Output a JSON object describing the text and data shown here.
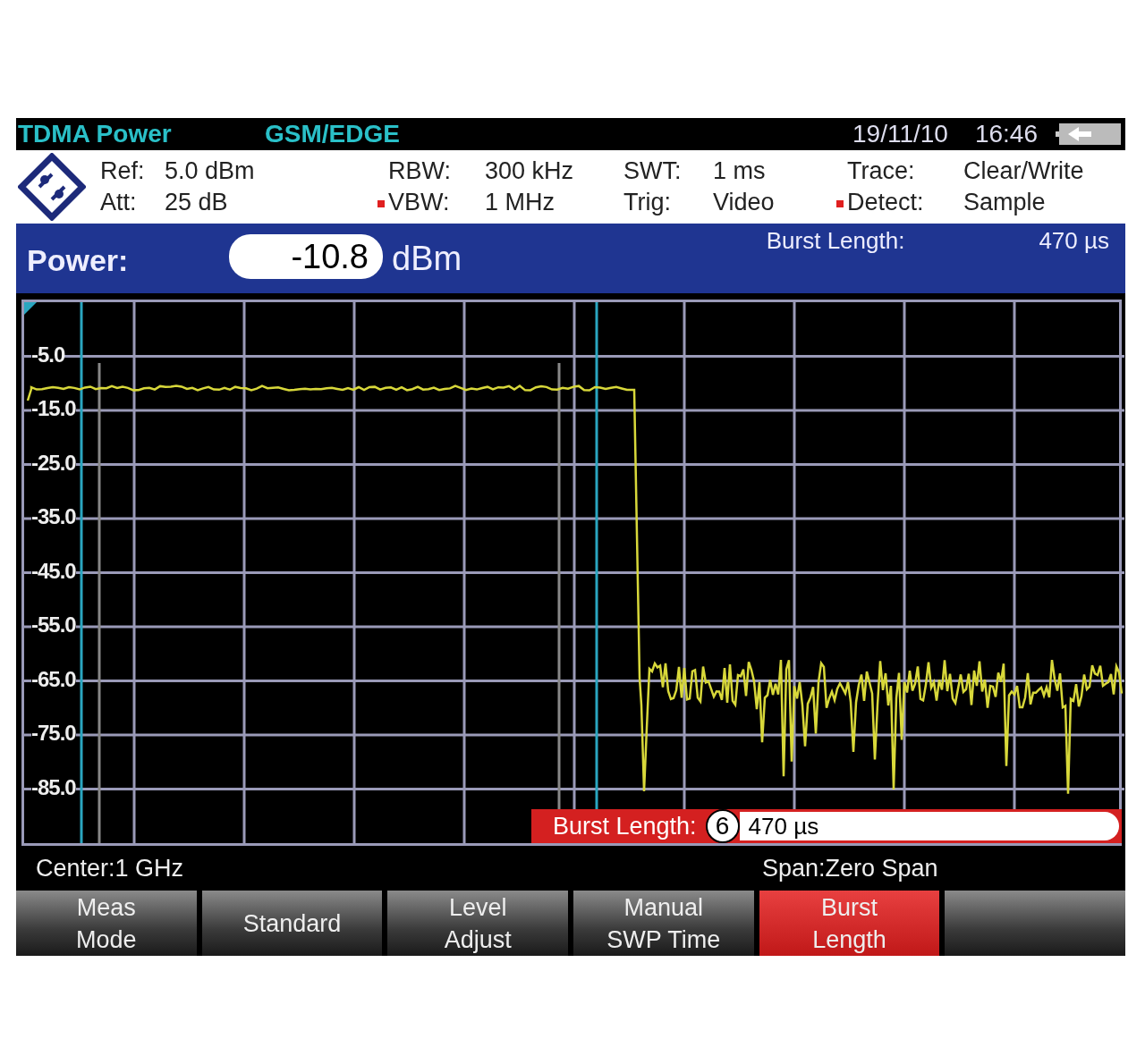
{
  "title_bar": {
    "mode": "TDMA Power",
    "standard": "GSM/EDGE",
    "date": "19/11/10",
    "time": "16:46"
  },
  "settings": [
    [
      {
        "label": "Ref:",
        "value": "5.0 dBm",
        "flagged": false
      },
      {
        "label": "RBW:",
        "value": "300 kHz",
        "flagged": false
      },
      {
        "label": "SWT:",
        "value": "1 ms",
        "flagged": false
      },
      {
        "label": "Trace:",
        "value": "Clear/Write",
        "flagged": false
      }
    ],
    [
      {
        "label": "Att:",
        "value": "25 dB",
        "flagged": false
      },
      {
        "label": "VBW:",
        "value": "1 MHz",
        "flagged": true
      },
      {
        "label": "Trig:",
        "value": "Video",
        "flagged": false
      },
      {
        "label": "Detect:",
        "value": "Sample",
        "flagged": true
      }
    ]
  ],
  "result": {
    "label": "Power:",
    "value": "-10.8",
    "unit": "dBm",
    "burst_label": "Burst Length:",
    "burst_value": "470 µs"
  },
  "plot": {
    "y_labels": [
      "-5.0",
      "-15.0",
      "-25.0",
      "-35.0",
      "-45.0",
      "-55.0",
      "-65.0",
      "-75.0",
      "-85.0"
    ]
  },
  "entry": {
    "label": "Burst Length:",
    "step": "6",
    "value": "470 µs"
  },
  "footer": {
    "center": "Center:1 GHz",
    "span": "Span:Zero Span"
  },
  "softkeys": [
    {
      "lines": [
        "Meas",
        "Mode"
      ],
      "selected": false
    },
    {
      "lines": [
        "Standard"
      ],
      "selected": false
    },
    {
      "lines": [
        "Level",
        "Adjust"
      ],
      "selected": false
    },
    {
      "lines": [
        "Manual",
        "SWP Time"
      ],
      "selected": false
    },
    {
      "lines": [
        "Burst",
        "Length"
      ],
      "selected": true
    }
  ]
}
